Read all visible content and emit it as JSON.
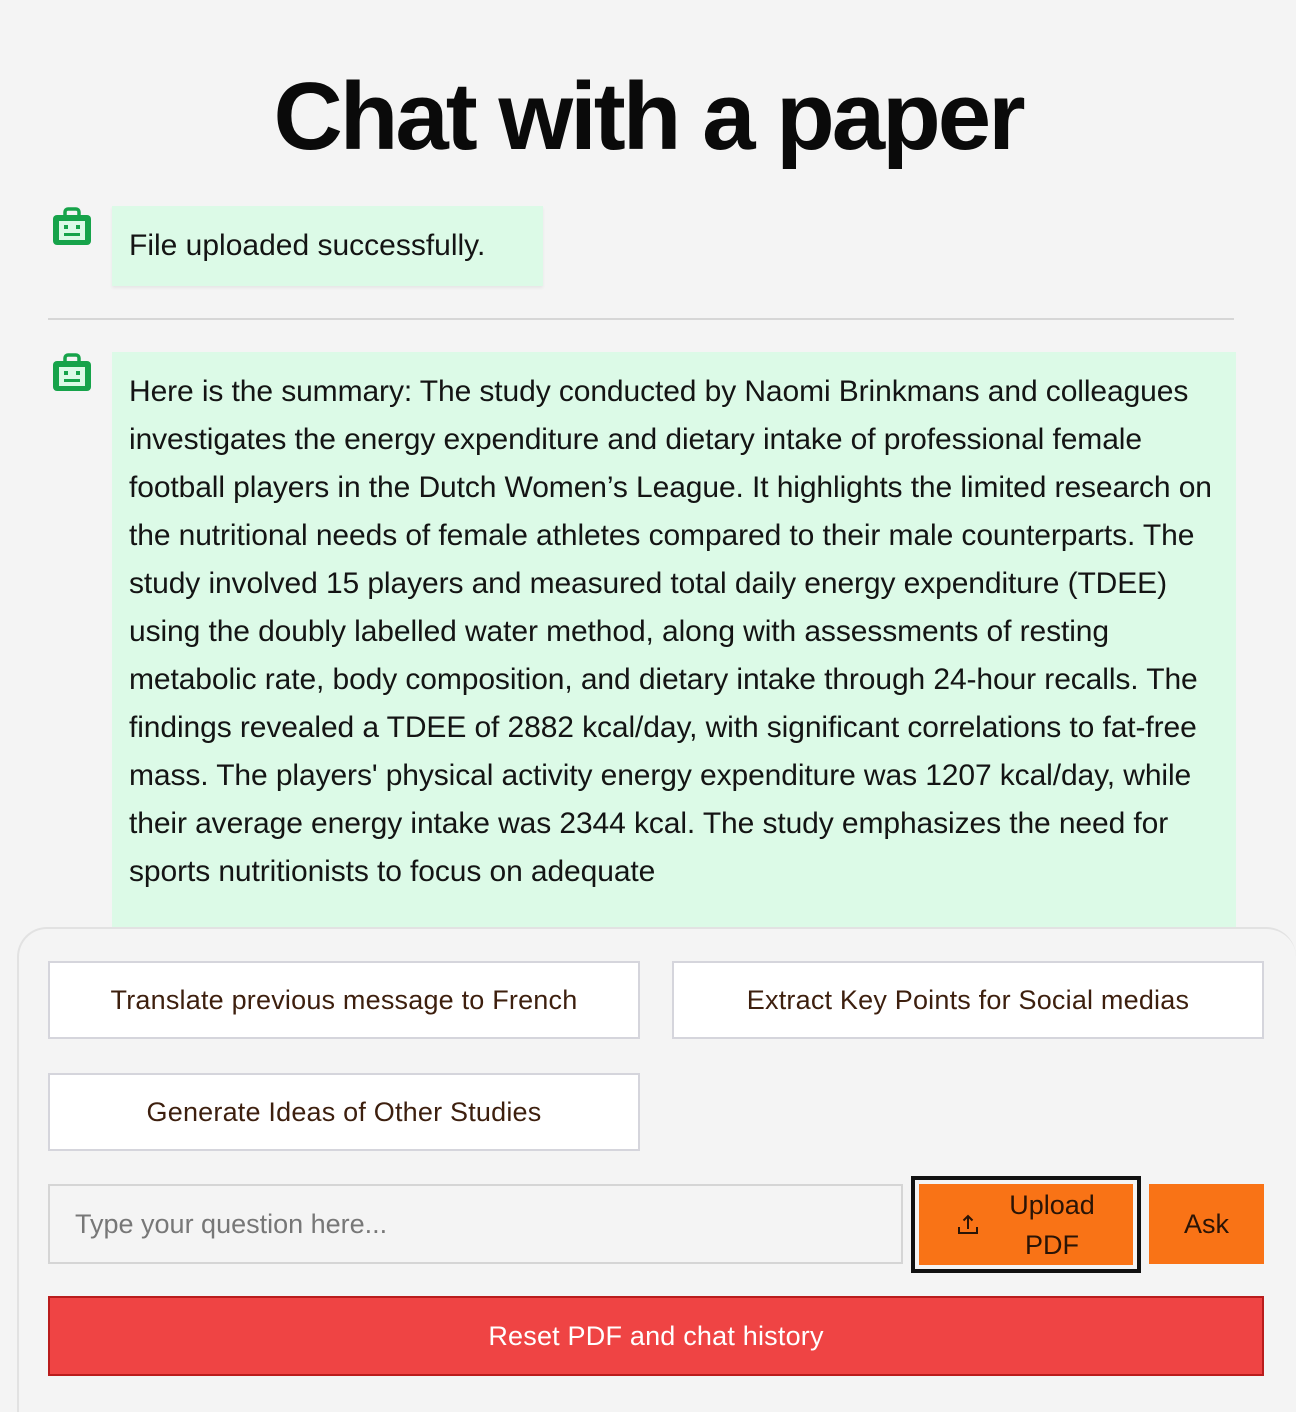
{
  "header": {
    "title": "Chat with a paper"
  },
  "messages": [
    {
      "role": "bot",
      "icon": "bot-icon",
      "text": "File uploaded successfully."
    },
    {
      "role": "bot",
      "icon": "bot-icon",
      "text": "Here is the summary: The study conducted by Naomi Brinkmans and colleagues investigates the energy expenditure and dietary intake of professional female football players in the Dutch Women’s League. It highlights the limited research on the nutritional needs of female athletes compared to their male counterparts. The study involved 15 players and measured total daily energy expenditure (TDEE) using the doubly labelled water method, along with assessments of resting metabolic rate, body composition, and dietary intake through 24-hour recalls. The findings revealed a TDEE of 2882 kcal/day, with significant correlations to fat-free mass. The players' physical activity energy expenditure was 1207 kcal/day, while their average energy intake was 2344 kcal. The study emphasizes the need for sports nutritionists to focus on adequate"
    }
  ],
  "actions": {
    "translate_label": "Translate previous message to French",
    "extract_label": "Extract Key Points for Social medias",
    "generate_label": "Generate Ideas of Other Studies"
  },
  "input": {
    "placeholder": "Type your question here...",
    "value": ""
  },
  "buttons": {
    "upload_label": "Upload PDF",
    "upload_icon": "upload-icon",
    "ask_label": "Ask",
    "reset_label": "Reset PDF and chat history"
  },
  "colors": {
    "bot_icon": "#16a34a",
    "bot_bubble": "#dcfae7",
    "accent_orange": "#f97316",
    "reset_red": "#ef4444",
    "button_text": "#3d1f0e"
  }
}
